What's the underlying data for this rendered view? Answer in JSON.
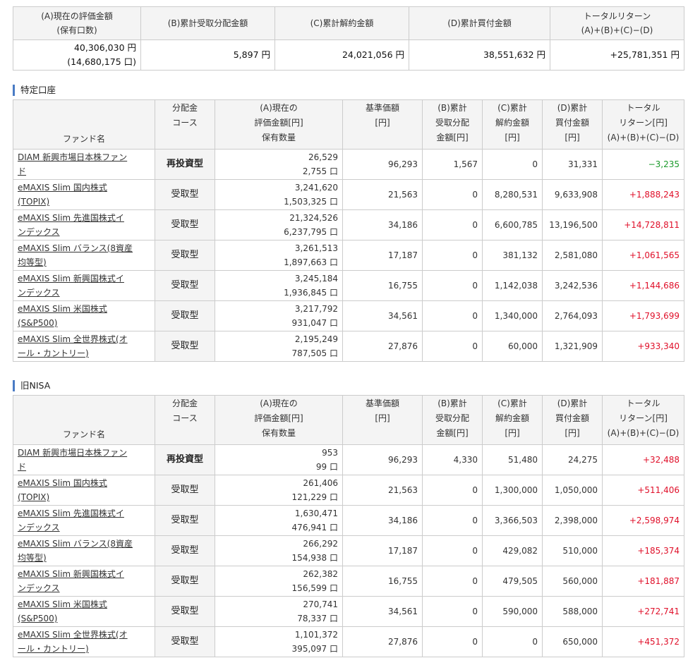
{
  "summary": {
    "headers": {
      "a": [
        "(A)現在の評価金額",
        "(保有口数)"
      ],
      "b": "(B)累計受取分配金額",
      "c": "(C)累計解約金額",
      "d": "(D)累計買付金額",
      "total": [
        "トータルリターン",
        "(A)+(B)+(C)−(D)"
      ]
    },
    "values": {
      "a_amount": "40,306,030 円",
      "a_units": "(14,680,175 口)",
      "b": "5,897 円",
      "c": "24,021,056 円",
      "d": "38,551,632 円",
      "total": "+25,781,351 円"
    }
  },
  "column_headers": {
    "fund": "ファンド名",
    "course": [
      "分配金",
      "コース"
    ],
    "value": [
      "(A)現在の",
      "評価金額[円]",
      "保有数量"
    ],
    "base_price": [
      "基準価額",
      "[円]"
    ],
    "dist": [
      "(B)累計",
      "受取分配",
      "金額[円]"
    ],
    "cancel": [
      "(C)累計",
      "解約金額",
      "[円]"
    ],
    "buy": [
      "(D)累計",
      "買付金額",
      "[円]"
    ],
    "total": [
      "トータル",
      "リターン[円]",
      "(A)+(B)+(C)−(D)"
    ]
  },
  "sections": [
    {
      "title": "特定口座",
      "rows": [
        {
          "name": [
            "DIAM 新興市場日本株ファン",
            "ド"
          ],
          "course": "再投資型",
          "value": "26,529",
          "units": "2,755 口",
          "base_price": "96,293",
          "dist": "1,567",
          "cancel": "0",
          "buy": "31,331",
          "total": "−3,235",
          "sign": "neg"
        },
        {
          "name": [
            "eMAXIS Slim 国内株式",
            "(TOPIX)"
          ],
          "course": "受取型",
          "value": "3,241,620",
          "units": "1,503,325 口",
          "base_price": "21,563",
          "dist": "0",
          "cancel": "8,280,531",
          "buy": "9,633,908",
          "total": "+1,888,243",
          "sign": "pos"
        },
        {
          "name": [
            "eMAXIS Slim 先進国株式イ",
            "ンデックス"
          ],
          "course": "受取型",
          "value": "21,324,526",
          "units": "6,237,795 口",
          "base_price": "34,186",
          "dist": "0",
          "cancel": "6,600,785",
          "buy": "13,196,500",
          "total": "+14,728,811",
          "sign": "pos"
        },
        {
          "name": [
            "eMAXIS Slim バランス(8資産",
            "均等型)"
          ],
          "course": "受取型",
          "value": "3,261,513",
          "units": "1,897,663 口",
          "base_price": "17,187",
          "dist": "0",
          "cancel": "381,132",
          "buy": "2,581,080",
          "total": "+1,061,565",
          "sign": "pos"
        },
        {
          "name": [
            "eMAXIS Slim 新興国株式イ",
            "ンデックス"
          ],
          "course": "受取型",
          "value": "3,245,184",
          "units": "1,936,845 口",
          "base_price": "16,755",
          "dist": "0",
          "cancel": "1,142,038",
          "buy": "3,242,536",
          "total": "+1,144,686",
          "sign": "pos"
        },
        {
          "name": [
            "eMAXIS Slim 米国株式",
            "(S&P500)"
          ],
          "course": "受取型",
          "value": "3,217,792",
          "units": "931,047 口",
          "base_price": "34,561",
          "dist": "0",
          "cancel": "1,340,000",
          "buy": "2,764,093",
          "total": "+1,793,699",
          "sign": "pos"
        },
        {
          "name": [
            "eMAXIS Slim 全世界株式(オ",
            "ール・カントリー)"
          ],
          "course": "受取型",
          "value": "2,195,249",
          "units": "787,505 口",
          "base_price": "27,876",
          "dist": "0",
          "cancel": "60,000",
          "buy": "1,321,909",
          "total": "+933,340",
          "sign": "pos"
        }
      ]
    },
    {
      "title": "旧NISA",
      "rows": [
        {
          "name": [
            "DIAM 新興市場日本株ファン",
            "ド"
          ],
          "course": "再投資型",
          "value": "953",
          "units": "99 口",
          "base_price": "96,293",
          "dist": "4,330",
          "cancel": "51,480",
          "buy": "24,275",
          "total": "+32,488",
          "sign": "pos"
        },
        {
          "name": [
            "eMAXIS Slim 国内株式",
            "(TOPIX)"
          ],
          "course": "受取型",
          "value": "261,406",
          "units": "121,229 口",
          "base_price": "21,563",
          "dist": "0",
          "cancel": "1,300,000",
          "buy": "1,050,000",
          "total": "+511,406",
          "sign": "pos"
        },
        {
          "name": [
            "eMAXIS Slim 先進国株式イ",
            "ンデックス"
          ],
          "course": "受取型",
          "value": "1,630,471",
          "units": "476,941 口",
          "base_price": "34,186",
          "dist": "0",
          "cancel": "3,366,503",
          "buy": "2,398,000",
          "total": "+2,598,974",
          "sign": "pos"
        },
        {
          "name": [
            "eMAXIS Slim バランス(8資産",
            "均等型)"
          ],
          "course": "受取型",
          "value": "266,292",
          "units": "154,938 口",
          "base_price": "17,187",
          "dist": "0",
          "cancel": "429,082",
          "buy": "510,000",
          "total": "+185,374",
          "sign": "pos"
        },
        {
          "name": [
            "eMAXIS Slim 新興国株式イ",
            "ンデックス"
          ],
          "course": "受取型",
          "value": "262,382",
          "units": "156,599 口",
          "base_price": "16,755",
          "dist": "0",
          "cancel": "479,505",
          "buy": "560,000",
          "total": "+181,887",
          "sign": "pos"
        },
        {
          "name": [
            "eMAXIS Slim 米国株式",
            "(S&P500)"
          ],
          "course": "受取型",
          "value": "270,741",
          "units": "78,337 口",
          "base_price": "34,561",
          "dist": "0",
          "cancel": "590,000",
          "buy": "588,000",
          "total": "+272,741",
          "sign": "pos"
        },
        {
          "name": [
            "eMAXIS Slim 全世界株式(オ",
            "ール・カントリー)"
          ],
          "course": "受取型",
          "value": "1,101,372",
          "units": "395,097 口",
          "base_price": "27,876",
          "dist": "0",
          "cancel": "0",
          "buy": "650,000",
          "total": "+451,372",
          "sign": "pos"
        }
      ]
    }
  ],
  "colors": {
    "positive": "#e0102a",
    "negative": "#1a9a2a",
    "header_bg": "#f4f4f4",
    "border": "#cccccc",
    "section_marker": "#4a7bc4"
  }
}
